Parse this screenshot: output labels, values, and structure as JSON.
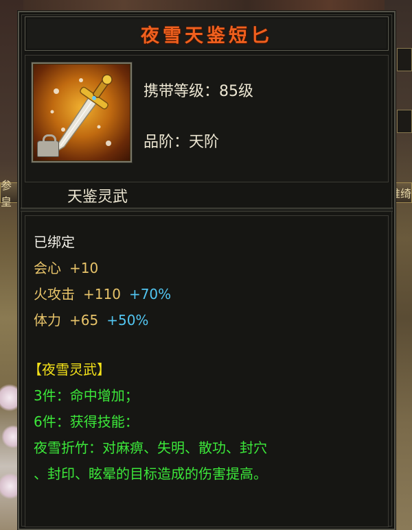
{
  "item": {
    "name": "夜雪天鉴短匕",
    "icon": "dagger-icon",
    "level_label": "携带等级：85级",
    "grade_label": "品阶：天阶",
    "category": "天鉴灵武"
  },
  "details": {
    "bind_status": "已绑定",
    "stats": [
      {
        "name": "会心",
        "value": "+10",
        "bonus": ""
      },
      {
        "name": "火攻击",
        "value": "+110",
        "bonus": "+70%"
      },
      {
        "name": "体力",
        "value": "+65",
        "bonus": "+50%"
      }
    ],
    "set": {
      "name": "【夜雪灵武】",
      "bonus_3": "3件：命中增加；",
      "bonus_6": "6件：获得技能：",
      "skill_line_1": "夜雪折竹：对麻痹、失明、散功、封穴",
      "skill_line_2": "、封印、眩晕的目标造成的伤害提高。"
    }
  },
  "background": {
    "left_tab": "参皇",
    "right_tab": "推绮"
  },
  "colors": {
    "title": "#f0601e",
    "stat_name": "#e8c46a",
    "bonus": "#52c6f2",
    "set_name": "#f4e21a",
    "set_text": "#3ce83a"
  }
}
